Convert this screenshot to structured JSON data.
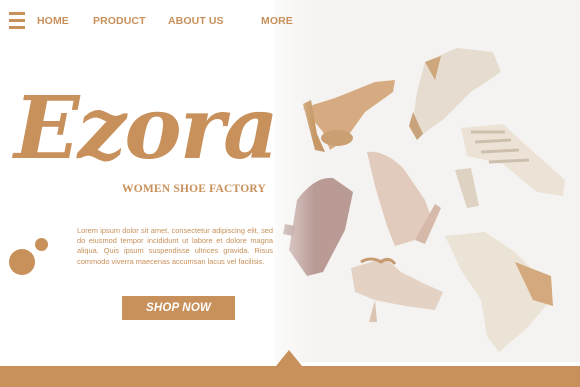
{
  "nav": {
    "menu_icon": "hamburger-menu-icon",
    "items": [
      {
        "label": "HOME"
      },
      {
        "label": "PRODUCT"
      },
      {
        "label": "ABOUT US"
      },
      {
        "label": "MORE"
      }
    ]
  },
  "hero": {
    "brand": "Ezora",
    "tagline": "WOMEN SHOE FACTORY",
    "description": "Lorem ipsum dolor sit amet, consectetur adipiscing elit, sed do eiusmod tempor incididunt ut labore et dolore magna aliqua. Quis ipsum suspendisse ultrices gravida. Risus commodo viverra maecenas accumsan lacus vel facilisis.",
    "cta_label": "SHOP NOW"
  },
  "colors": {
    "accent": "#c8905a",
    "background": "#ffffff"
  }
}
